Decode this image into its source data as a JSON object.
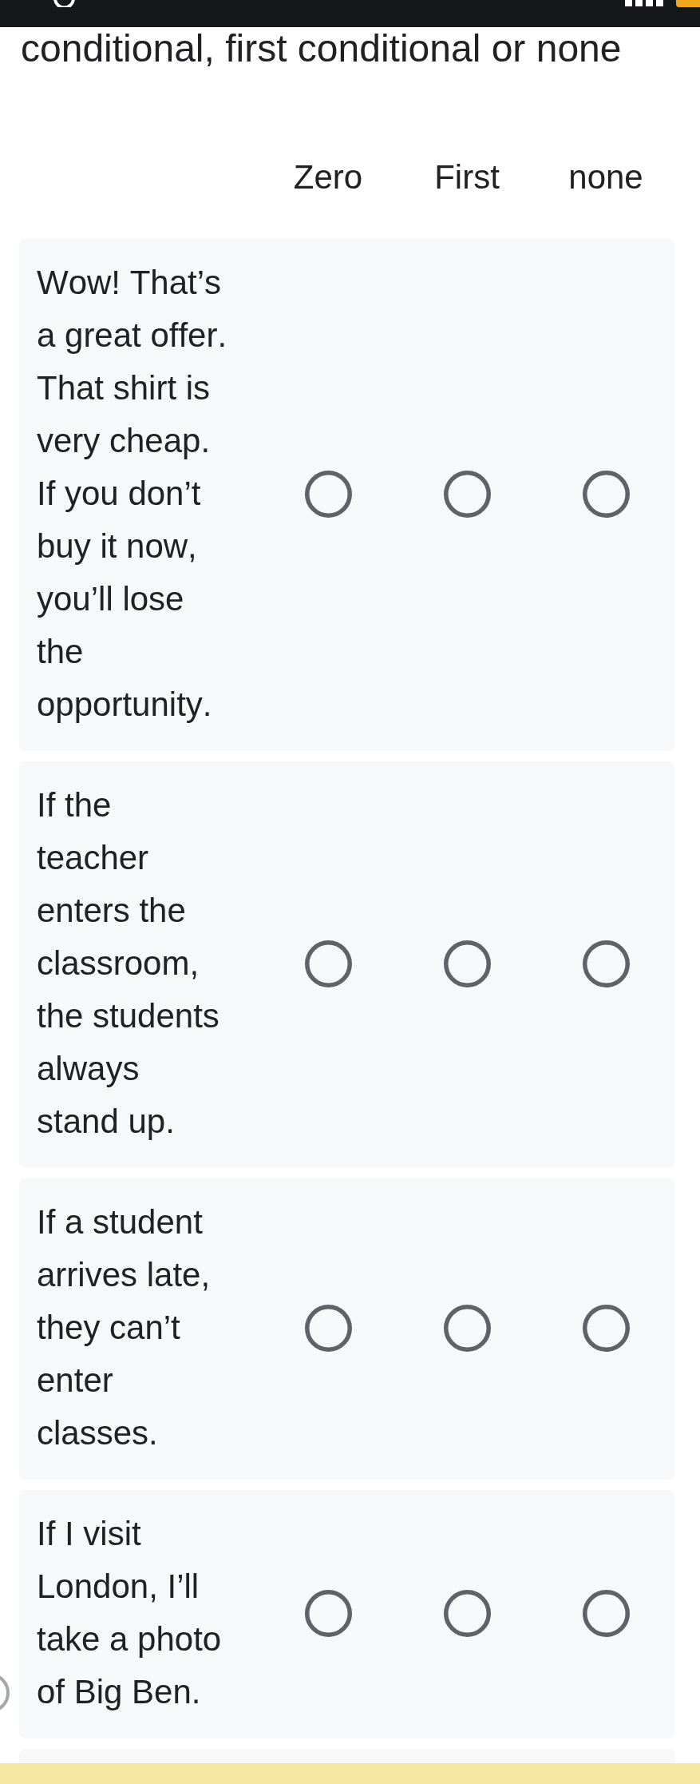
{
  "question": {
    "title": "conditional, first conditional or none"
  },
  "grid": {
    "columns": [
      "Zero",
      "First",
      "none"
    ],
    "rows": [
      {
        "text": "Wow! That’s a great offer. That shirt is very cheap. If you don’t buy it now, you’ll lose the opportunity.",
        "choices": [
          {
            "selected": false
          },
          {
            "selected": false
          },
          {
            "selected": false
          }
        ]
      },
      {
        "text": "If the teacher enters the classroom, the students always stand up.",
        "choices": [
          {
            "selected": false
          },
          {
            "selected": false
          },
          {
            "selected": false
          }
        ]
      },
      {
        "text": "If a student arrives late, they can’t enter classes.",
        "choices": [
          {
            "selected": false
          },
          {
            "selected": false
          },
          {
            "selected": false
          }
        ]
      },
      {
        "text": "If I visit London, I’ll take a photo of Big Ben.",
        "choices": [
          {
            "selected": false
          },
          {
            "selected": false
          },
          {
            "selected": false
          }
        ]
      }
    ]
  }
}
